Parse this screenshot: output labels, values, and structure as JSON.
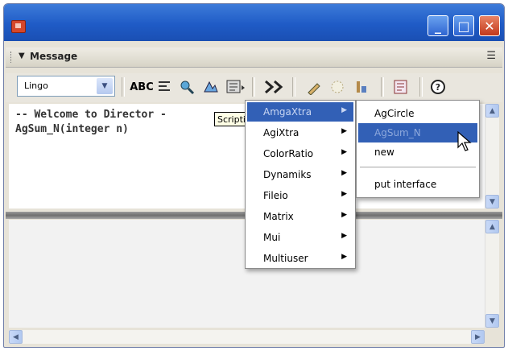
{
  "window": {
    "minimize_glyph": "_",
    "maximize_glyph": "□",
    "close_glyph": "✕"
  },
  "panel": {
    "title": "Message",
    "collapse_glyph": "▼"
  },
  "toolbar": {
    "language_value": "Lingo",
    "icons": [
      "abc-check-icon",
      "alphabetize-icon",
      "watch-expression-icon",
      "trace-icon",
      "scripting-xtras-icon",
      "trace-toggle-icon",
      "object-inspector-icon",
      "behavior-icon",
      "cast-member-icon",
      "script-window-icon",
      "help-icon"
    ]
  },
  "editor": {
    "lines": [
      "-- Welcome to Director -",
      "AgSum_N(integer n)"
    ],
    "tooltip": "Scripting Xtras"
  },
  "menu": {
    "items": [
      {
        "label": "AmgaXtra",
        "submenu": true
      },
      {
        "label": "AgiXtra",
        "submenu": true
      },
      {
        "label": "ColorRatio",
        "submenu": true
      },
      {
        "label": "Dynamiks",
        "submenu": true
      },
      {
        "label": "Fileio",
        "submenu": true
      },
      {
        "label": "Matrix",
        "submenu": true
      },
      {
        "label": "Mui",
        "submenu": true
      },
      {
        "label": "Multiuser",
        "submenu": true
      }
    ],
    "selected_index": 0
  },
  "submenu": {
    "items": [
      "AgCircle",
      "AgSum_N",
      "new",
      "put interface"
    ],
    "selected_index": 1
  },
  "colors": {
    "title_bar": "#1f5bc6",
    "menu_highlight": "#3260b6",
    "close_button": "#c2391c"
  }
}
